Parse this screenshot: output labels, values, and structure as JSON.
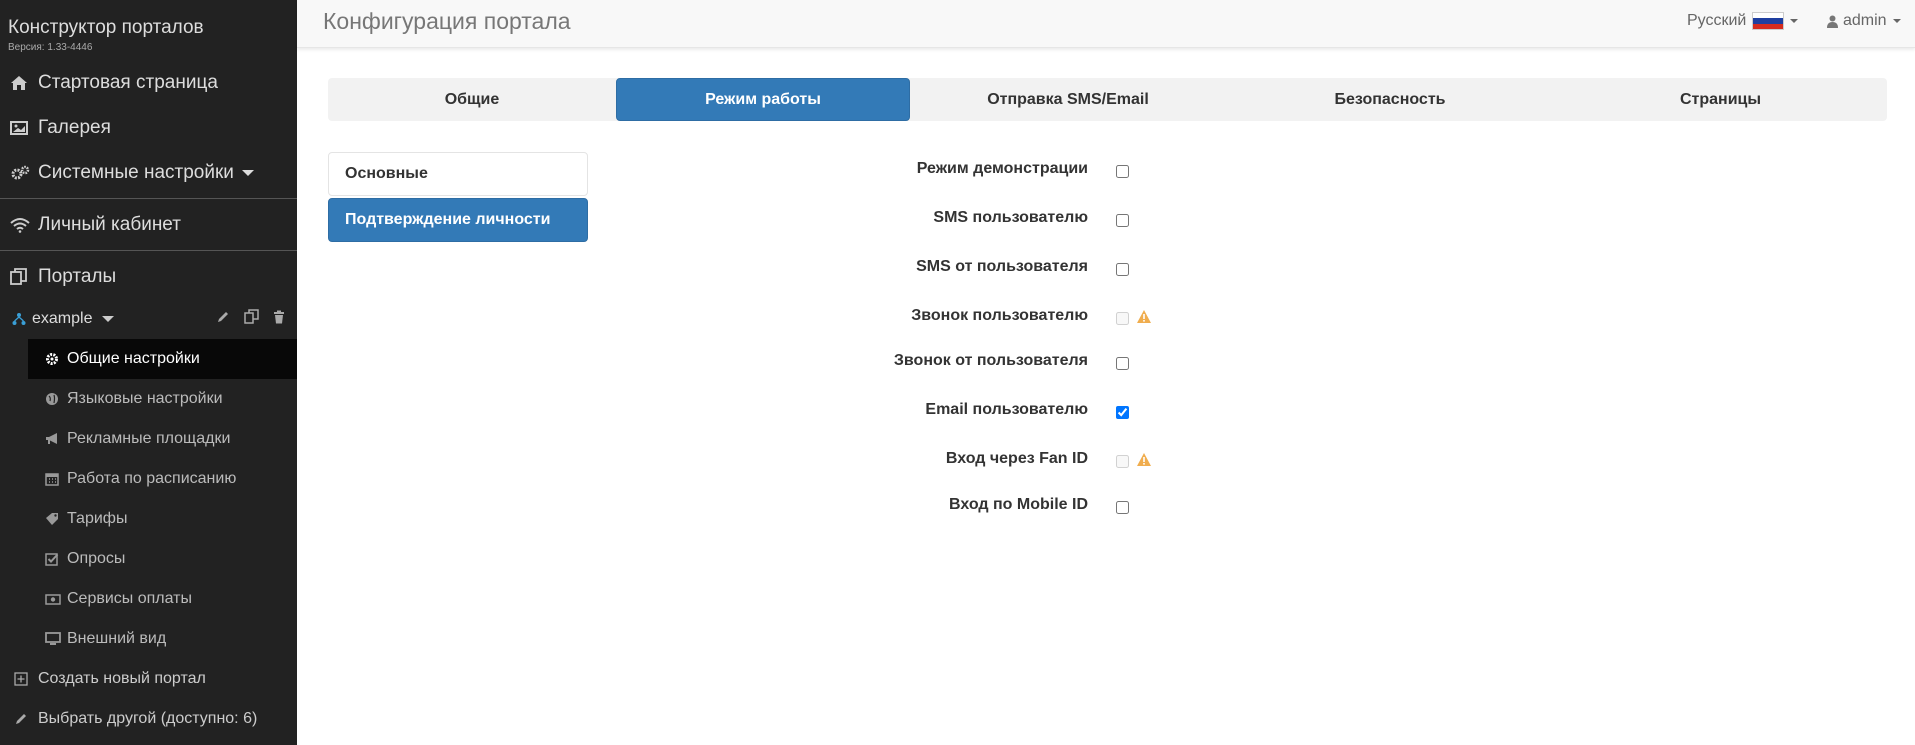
{
  "sidebar": {
    "brand_title": "Конструктор порталов",
    "brand_version": "Версия: 1.33-4446",
    "nav": {
      "home": "Стартовая страница",
      "gallery": "Галерея",
      "system": "Системные настройки",
      "cabinet": "Личный кабинет",
      "portals": "Порталы"
    },
    "portal_name": "example",
    "sub_items": [
      {
        "label": "Общие настройки",
        "icon": "gear-icon"
      },
      {
        "label": "Языковые настройки",
        "icon": "globe-icon"
      },
      {
        "label": "Рекламные площадки",
        "icon": "bullhorn-icon"
      },
      {
        "label": "Работа по расписанию",
        "icon": "calendar-icon"
      },
      {
        "label": "Тарифы",
        "icon": "tag-icon"
      },
      {
        "label": "Опросы",
        "icon": "checkbox-icon"
      },
      {
        "label": "Сервисы оплаты",
        "icon": "money-icon"
      },
      {
        "label": "Внешний вид",
        "icon": "monitor-icon"
      }
    ],
    "create_portal": "Создать новый портал",
    "choose_other": "Выбрать другой (доступно: 6)"
  },
  "topbar": {
    "title": "Конфигурация портала",
    "language": "Русский",
    "user": "admin"
  },
  "tabs": [
    "Общие",
    "Режим работы",
    "Отправка SMS/Email",
    "Безопасность",
    "Страницы"
  ],
  "active_tab": "Режим работы",
  "pills": [
    "Основные",
    "Подтверждение личности"
  ],
  "active_pill": "Подтверждение личности",
  "form_rows": [
    {
      "label": "Режим демонстрации",
      "checked": false,
      "disabled": false,
      "warning": false
    },
    {
      "label": "SMS пользователю",
      "checked": false,
      "disabled": false,
      "warning": false
    },
    {
      "label": "SMS от пользователя",
      "checked": false,
      "disabled": false,
      "warning": false
    },
    {
      "label": "Звонок пользователю",
      "checked": false,
      "disabled": true,
      "warning": true
    },
    {
      "label": "Звонок от пользователя",
      "checked": false,
      "disabled": false,
      "warning": false
    },
    {
      "label": "Email пользователю",
      "checked": true,
      "disabled": false,
      "warning": false
    },
    {
      "label": "Вход через Fan ID",
      "checked": false,
      "disabled": true,
      "warning": true
    },
    {
      "label": "Вход по Mobile ID",
      "checked": false,
      "disabled": false,
      "warning": false
    }
  ],
  "colors": {
    "sidebar_bg": "#222222",
    "accent": "#337ab7",
    "warning": "#f0ad4e"
  }
}
